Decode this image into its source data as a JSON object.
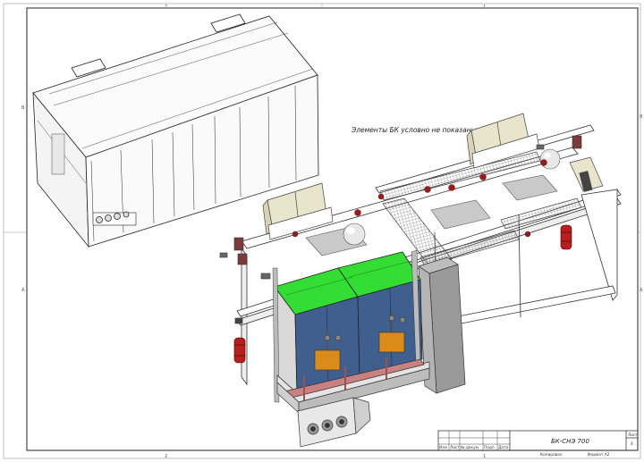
{
  "drawing": {
    "note": "Элементы БК условно не показаны",
    "title_block": {
      "designation": "БК-СНЭ 700",
      "format": "Формат А2",
      "copied": "Копировал",
      "sheet_label": "Лист",
      "sheet_number": "4",
      "columns": [
        "Изм",
        "Лист",
        "№ докум.",
        "Подп.",
        "Дата"
      ]
    },
    "zone_labels": {
      "top_a": "2",
      "top_b": "1",
      "bottom_a": "2",
      "bottom_b": "1",
      "left_b": "B",
      "left_a": "A",
      "right_b": "B",
      "right_a": "A"
    }
  },
  "colors": {
    "frame": "#222222",
    "panel_blue": "#3f5f8f",
    "panel_green": "#33dd33",
    "cabinet_cream": "#e9e4cc",
    "extinguisher_red": "#b81e1e",
    "duct_gray": "#9a9a9a"
  }
}
